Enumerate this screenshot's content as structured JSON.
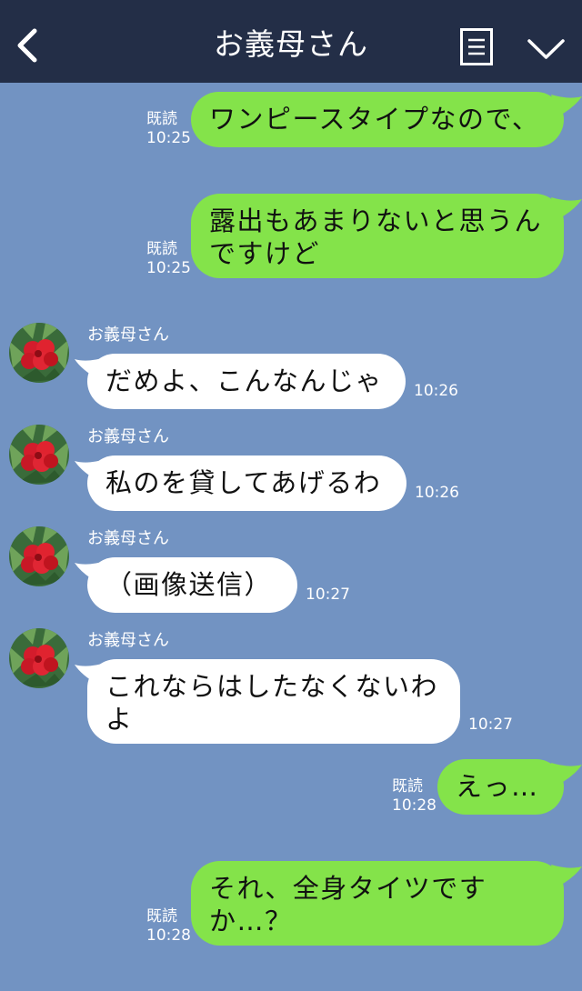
{
  "header": {
    "title": "お義母さん",
    "colors": {
      "bar": "#232e47",
      "icon": "#ffffff"
    }
  },
  "colors": {
    "background": "#7293c2",
    "sent_bubble": "#84e34a",
    "received_bubble": "#ffffff"
  },
  "messages": [
    {
      "id": "m1",
      "direction": "sent",
      "text": "ワンピースタイプなので、",
      "read": "既読",
      "time": "10:25"
    },
    {
      "id": "m2",
      "direction": "sent",
      "text": "露出もあまりないと思うんですけど",
      "read": "既読",
      "time": "10:25"
    },
    {
      "id": "m3",
      "direction": "received",
      "sender": "お義母さん",
      "text": "だめよ、こんなんじゃ",
      "time": "10:26"
    },
    {
      "id": "m4",
      "direction": "received",
      "sender": "お義母さん",
      "text": "私のを貸してあげるわ",
      "time": "10:26"
    },
    {
      "id": "m5",
      "direction": "received",
      "sender": "お義母さん",
      "text": "（画像送信）",
      "time": "10:27"
    },
    {
      "id": "m6",
      "direction": "received",
      "sender": "お義母さん",
      "text": "これならはしたなくないわよ",
      "time": "10:27"
    },
    {
      "id": "m7",
      "direction": "sent",
      "text": "えっ…",
      "read": "既読",
      "time": "10:28"
    },
    {
      "id": "m8",
      "direction": "sent",
      "text": "それ、全身タイツですか…？",
      "read": "既読",
      "time": "10:28"
    }
  ],
  "avatar": {
    "icon": "red-flower-avatar"
  }
}
